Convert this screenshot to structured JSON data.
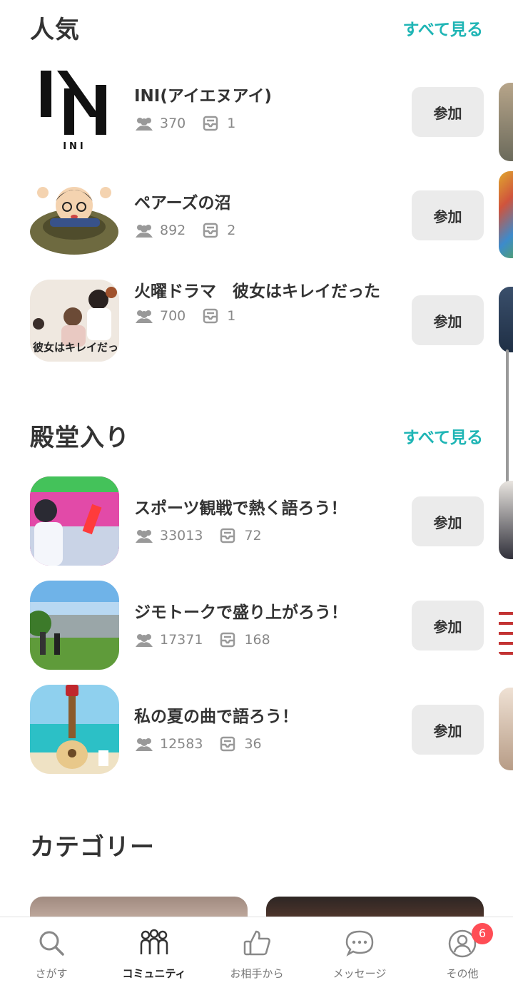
{
  "popular": {
    "title": "人気",
    "see_all": "すべて見る",
    "items": [
      {
        "name": "INI(アイエヌアイ)",
        "members": "370",
        "posts": "1",
        "button": "参加",
        "logo_text": "INI"
      },
      {
        "name": "ペアーズの沼",
        "members": "892",
        "posts": "2",
        "button": "参加"
      },
      {
        "name": "火曜ドラマ　彼女はキレイだった",
        "members": "700",
        "posts": "1",
        "button": "参加",
        "thumb_text": "彼女はキレイだった"
      }
    ]
  },
  "hall_of_fame": {
    "title": "殿堂入り",
    "see_all": "すべて見る",
    "items": [
      {
        "name": "スポーツ観戦で熱く語ろう！",
        "members": "33013",
        "posts": "72",
        "button": "参加"
      },
      {
        "name": "ジモトークで盛り上がろう！",
        "members": "17371",
        "posts": "168",
        "button": "参加"
      },
      {
        "name": "私の夏の曲で語ろう！",
        "members": "12583",
        "posts": "36",
        "button": "参加"
      }
    ]
  },
  "category": {
    "title": "カテゴリー"
  },
  "tabbar": {
    "tabs": [
      {
        "label": "さがす",
        "icon": "search-icon"
      },
      {
        "label": "コミュニティ",
        "icon": "community-icon",
        "active": true
      },
      {
        "label": "お相手から",
        "icon": "thumbs-up-icon"
      },
      {
        "label": "メッセージ",
        "icon": "chat-icon"
      },
      {
        "label": "その他",
        "icon": "profile-icon",
        "badge": "6"
      }
    ]
  },
  "colors": {
    "accent": "#1fb5b5",
    "badge": "#ff4d55",
    "button_bg": "#ebebeb"
  }
}
